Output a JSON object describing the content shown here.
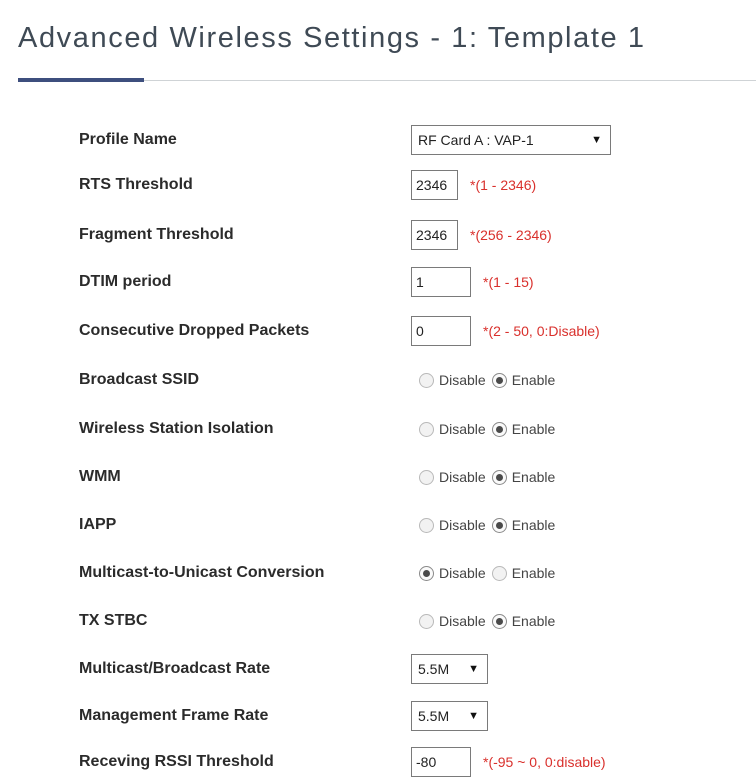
{
  "page": {
    "title": "Advanced Wireless Settings - 1: Template 1"
  },
  "rows": {
    "profile_name": {
      "label": "Profile Name",
      "value": "RF Card A : VAP-1"
    },
    "rts_threshold": {
      "label": "RTS Threshold",
      "value": "2346",
      "hint": "*(1 - 2346)"
    },
    "fragment_threshold": {
      "label": "Fragment Threshold",
      "value": "2346",
      "hint": "*(256 - 2346)"
    },
    "dtim_period": {
      "label": "DTIM period",
      "value": "1",
      "hint": "*(1 - 15)"
    },
    "consecutive_dropped": {
      "label": "Consecutive Dropped Packets",
      "value": "0",
      "hint": "*(2 - 50, 0:Disable)"
    },
    "broadcast_ssid": {
      "label": "Broadcast SSID",
      "disable": "Disable",
      "enable": "Enable",
      "selected": "Enable"
    },
    "station_isolation": {
      "label": "Wireless Station Isolation",
      "disable": "Disable",
      "enable": "Enable",
      "selected": "Enable"
    },
    "wmm": {
      "label": "WMM",
      "disable": "Disable",
      "enable": "Enable",
      "selected": "Enable"
    },
    "iapp": {
      "label": "IAPP",
      "disable": "Disable",
      "enable": "Enable",
      "selected": "Enable"
    },
    "multicast_unicast": {
      "label": "Multicast-to-Unicast Conversion",
      "disable": "Disable",
      "enable": "Enable",
      "selected": "Disable"
    },
    "tx_stbc": {
      "label": "TX STBC",
      "disable": "Disable",
      "enable": "Enable",
      "selected": "Enable"
    },
    "multicast_rate": {
      "label": "Multicast/Broadcast Rate",
      "value": "5.5M"
    },
    "mgmt_frame_rate": {
      "label": "Management Frame Rate",
      "value": "5.5M"
    },
    "rssi_threshold": {
      "label": "Receving RSSI Threshold",
      "value": "-80",
      "hint": "*(-95 ~ 0, 0:disable)"
    }
  }
}
